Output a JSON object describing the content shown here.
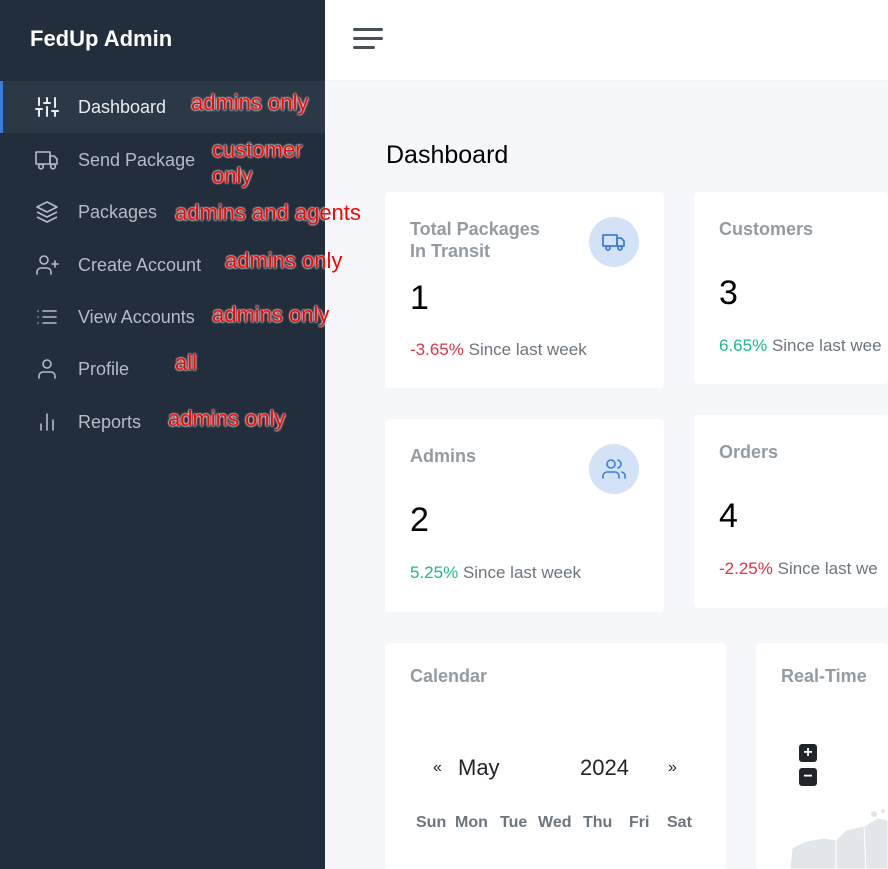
{
  "brand": "FedUp Admin",
  "sidebar": {
    "items": [
      {
        "label": "Dashboard",
        "icon": "sliders-icon",
        "note": "admins only"
      },
      {
        "label": "Send Package",
        "icon": "truck-icon",
        "note": "customer\nonly"
      },
      {
        "label": "Packages",
        "icon": "layers-icon",
        "note": "admins and agents"
      },
      {
        "label": "Create Account",
        "icon": "user-plus-icon",
        "note": "admins only"
      },
      {
        "label": "View Accounts",
        "icon": "list-icon",
        "note": "admins only"
      },
      {
        "label": "Profile",
        "icon": "user-icon",
        "note": "all"
      },
      {
        "label": "Reports",
        "icon": "bar-chart-icon",
        "note": "admins only"
      }
    ]
  },
  "page_title": "Dashboard",
  "cards": {
    "total_packages": {
      "title": "Total Packages\nIn Transit",
      "value": "1",
      "change": "-3.65%",
      "since": "Since last week"
    },
    "customers": {
      "title": "Customers",
      "value": "3",
      "change": "6.65%",
      "since": "Since last wee"
    },
    "admins": {
      "title": "Admins",
      "value": "2",
      "change": "5.25%",
      "since": "Since last week"
    },
    "orders": {
      "title": "Orders",
      "value": "4",
      "change": "-2.25%",
      "since": "Since last we"
    }
  },
  "calendar": {
    "title": "Calendar",
    "prev": "«",
    "next": "»",
    "month": "May",
    "year": "2024",
    "weekdays": [
      "Sun",
      "Mon",
      "Tue",
      "Wed",
      "Thu",
      "Fri",
      "Sat"
    ]
  },
  "realtime": {
    "title": "Real-Time",
    "zoom_in": "+",
    "zoom_out": "−"
  },
  "colors": {
    "sidebar": "#222e3c",
    "accent": "#3b7ddd",
    "negative": "#dc3545",
    "positive": "#1cbb8c"
  }
}
